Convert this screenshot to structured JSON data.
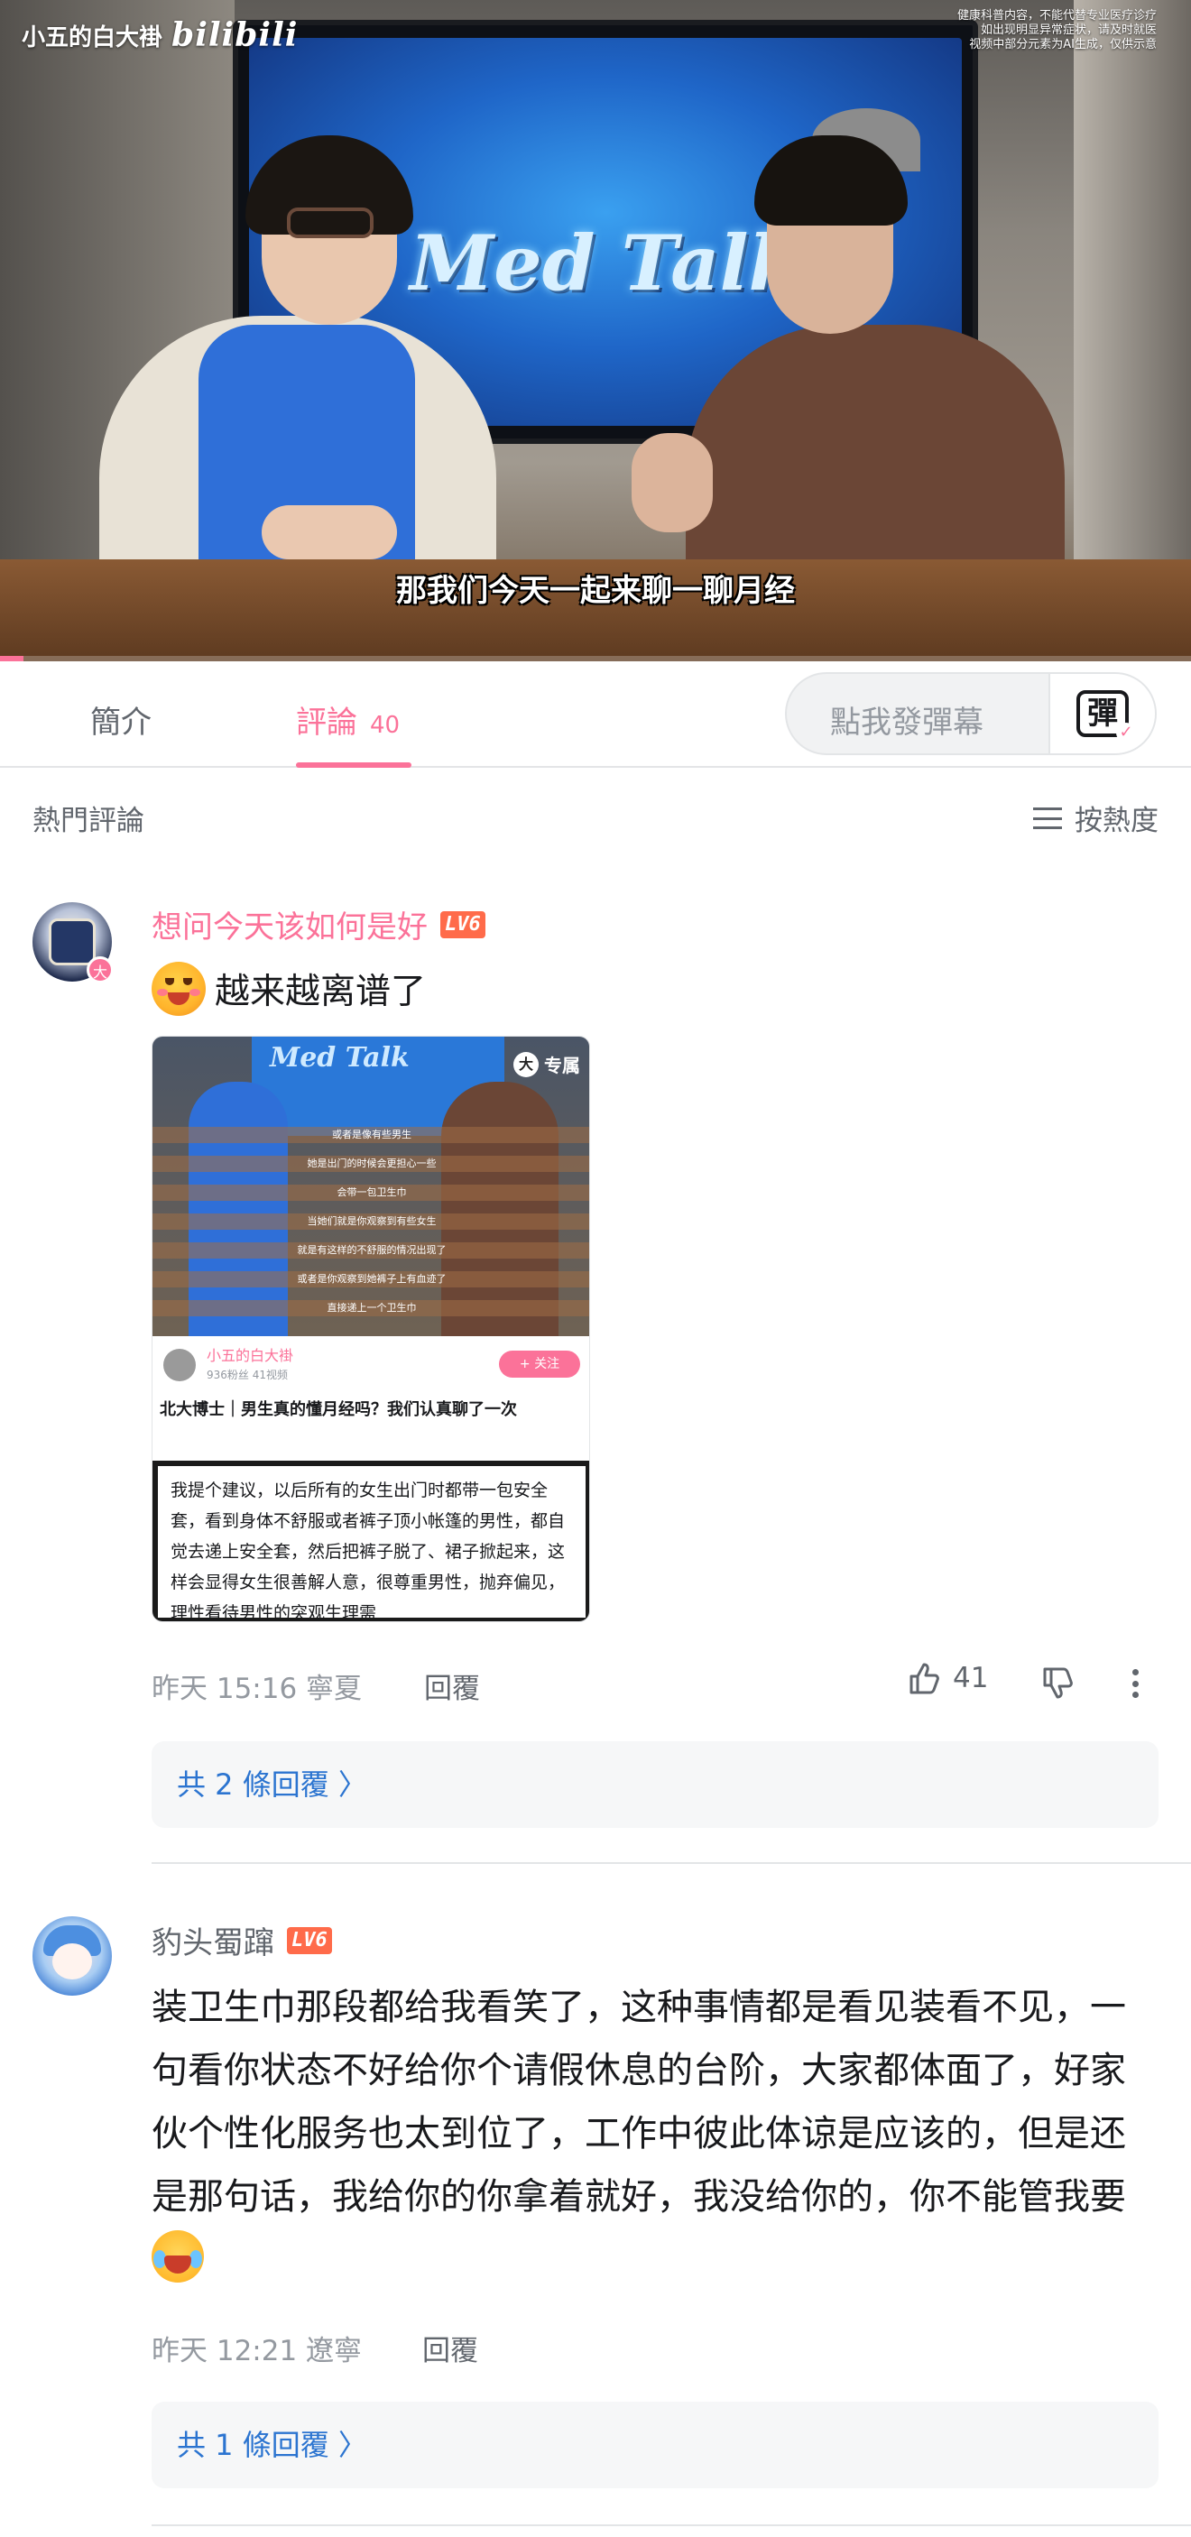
{
  "video": {
    "channel_label": "小五的白大褂",
    "brand": "bilibili",
    "notice": [
      "健康科普内容，不能代替专业医疗诊疗",
      "如出现明显异常症状，请及时就医",
      "视频中部分元素为AI生成，仅供示意"
    ],
    "subtitle": "那我们今天一起来聊一聊月经",
    "screen_title": "Med Talk",
    "progress_fraction": 0.02
  },
  "tabs": {
    "intro": "簡介",
    "comments": "評論",
    "comments_count": "40"
  },
  "danmaku": {
    "placeholder": "點我發彈幕",
    "button_glyph": "彈"
  },
  "comments_header": {
    "title": "熱門評論",
    "sort_label": "按熱度"
  },
  "comments": [
    {
      "username": "想问今天该如何是好",
      "level": "LV6",
      "avatar_badge": "大",
      "text": "越来越离谱了",
      "image": {
        "badge": "专属",
        "screen_title": "Med Talk",
        "subtitle_lines": [
          "或者是像有些男生",
          "她是出门的时候会更担心一些",
          "会带一包卫生巾",
          "当她们就是你观察到有些女生",
          "就是有这样的不舒服的情况出现了",
          "或者是你观察到她裤子上有血迹了",
          "直接递上一个卫生巾"
        ],
        "channel_name": "小五的白大褂",
        "channel_meta": "936粉丝   41视频",
        "follow_label": "+ 关注",
        "video_title": "北大博士｜男生真的懂月经吗？我们认真聊了一次",
        "note_text": "我提个建议，以后所有的女生出门时都带一包安全套，看到身体不舒服或者裤子顶小帐篷的男性，都自觉去递上安全套，然后把裤子脱了、裙子掀起来，这样会显得女生很善解人意，很尊重男性，抛弃偏见，理性看待男性的突观生理需"
      },
      "meta": "昨天 15:16 寧夏",
      "reply_label": "回覆",
      "likes": "41",
      "replies_label": "共 2 條回覆 〉"
    },
    {
      "username": "豹头蜀蹿",
      "level": "LV6",
      "text": "装卫生巾那段都给我看笑了，这种事情都是看见装看不见，一句看你状态不好给你个请假休息的台阶，大家都体面了，好家伙个性化服务也太到位了，工作中彼此体谅是应该的，但是还是那句话，我给你的你拿着就好，我没给你的，你不能管我要",
      "meta": "昨天 12:21 遼寧",
      "reply_label": "回覆",
      "replies_label": "共 1 條回覆 〉"
    }
  ],
  "colors": {
    "accent_pink": "#fb7299",
    "link_blue": "#2b74d0",
    "level_orange": "#ff6b4a"
  }
}
